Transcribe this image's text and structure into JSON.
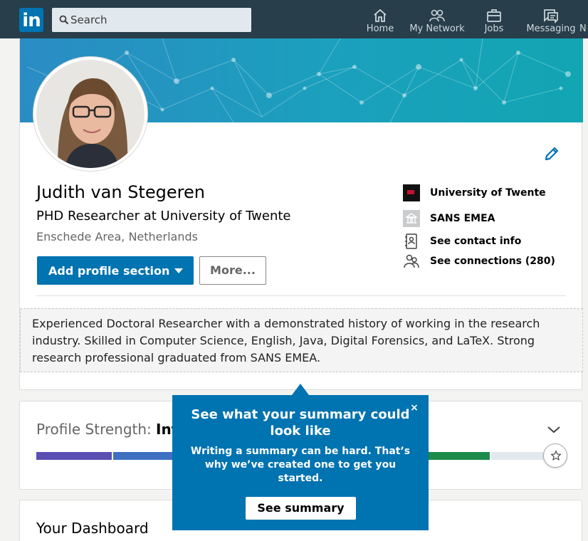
{
  "nav": {
    "logo_text": "in",
    "search": {
      "placeholder": "Search"
    },
    "items": [
      {
        "label": "Home",
        "icon": "home-icon"
      },
      {
        "label": "My Network",
        "icon": "network-icon"
      },
      {
        "label": "Jobs",
        "icon": "briefcase-icon"
      },
      {
        "label": "Messaging",
        "icon": "messaging-icon"
      },
      {
        "label": "N",
        "icon": ""
      }
    ]
  },
  "profile": {
    "name": "Judith van Stegeren",
    "headline": "PHD Researcher at University of Twente",
    "location": "Enschede Area, Netherlands",
    "add_section_label": "Add profile section",
    "more_label": "More...",
    "side": {
      "company": "University of Twente",
      "school": "SANS EMEA",
      "contact": "See contact info",
      "connections": "See connections (280)"
    },
    "summary": "Experienced Doctoral Researcher with a demonstrated history of working in the research industry. Skilled in Computer Science, English, Java, Digital Forensics, and LaTeX. Strong research professional graduated from SANS EMEA."
  },
  "strength": {
    "label": "Profile Strength:",
    "value_visible": "Int",
    "segment_colors": [
      "#5a4fb3",
      "#3e6fc0",
      "#1d8c4a",
      "#e1e9ee"
    ]
  },
  "dashboard": {
    "title": "Your Dashboard"
  },
  "popover": {
    "title": "See what your summary could look like",
    "body": "Writing a summary can be hard. That’s why we’ve created one to get you started.",
    "button": "See summary",
    "close": "×"
  },
  "colors": {
    "brand": "#0073b1",
    "nav_bg": "#283e4a"
  }
}
